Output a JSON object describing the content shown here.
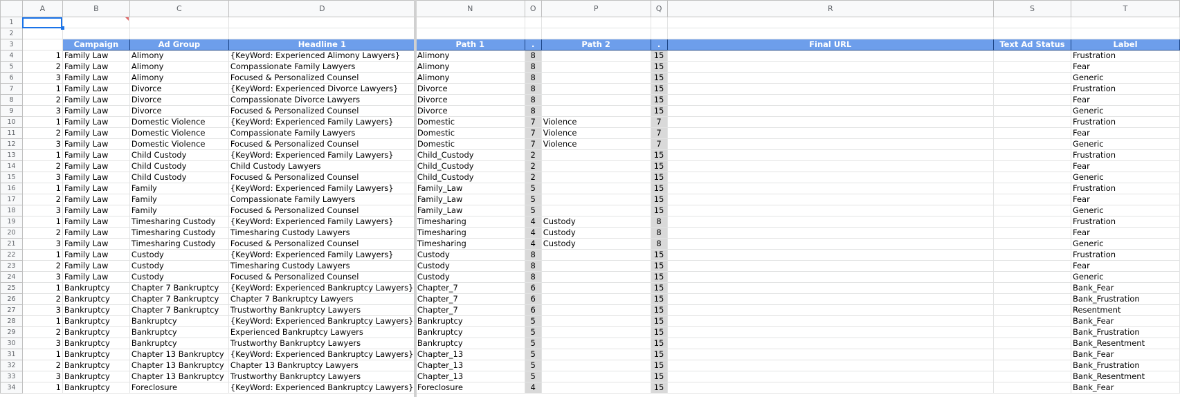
{
  "columns": [
    "",
    "A",
    "B",
    "C",
    "D",
    "N",
    "O",
    "P",
    "Q",
    "R",
    "S",
    "T"
  ],
  "row_numbers": [
    1,
    2,
    3,
    4,
    5,
    6,
    7,
    8,
    9,
    10,
    11,
    12,
    13,
    14,
    15,
    16,
    17,
    18,
    19,
    20,
    21,
    22,
    23,
    24,
    25,
    26,
    27,
    28,
    29,
    30,
    31,
    32,
    33,
    34
  ],
  "headers": {
    "campaign": "Campaign",
    "ad_group": "Ad Group",
    "headline1": "Headline 1",
    "path1": "Path 1",
    "dot1": ".",
    "path2": "Path 2",
    "dot2": ".",
    "final_url": "Final URL",
    "status": "Text Ad Status",
    "label": "Label"
  },
  "rows": [
    [
      "1",
      "Family Law",
      "Alimony",
      "{KeyWord: Experienced Alimony Lawyers}",
      "Alimony",
      "8",
      "",
      "15",
      "",
      "",
      "Frustration"
    ],
    [
      "2",
      "Family Law",
      "Alimony",
      "Compassionate Family Lawyers",
      "Alimony",
      "8",
      "",
      "15",
      "",
      "",
      "Fear"
    ],
    [
      "3",
      "Family Law",
      "Alimony",
      "Focused & Personalized Counsel",
      "Alimony",
      "8",
      "",
      "15",
      "",
      "",
      "Generic"
    ],
    [
      "1",
      "Family Law",
      "Divorce",
      "{KeyWord: Experienced Divorce Lawyers}",
      "Divorce",
      "8",
      "",
      "15",
      "",
      "",
      "Frustration"
    ],
    [
      "2",
      "Family Law",
      "Divorce",
      "Compassionate Divorce Lawyers",
      "Divorce",
      "8",
      "",
      "15",
      "",
      "",
      "Fear"
    ],
    [
      "3",
      "Family Law",
      "Divorce",
      "Focused & Personalized Counsel",
      "Divorce",
      "8",
      "",
      "15",
      "",
      "",
      "Generic"
    ],
    [
      "1",
      "Family Law",
      "Domestic Violence",
      "{KeyWord: Experienced Family Lawyers}",
      "Domestic",
      "7",
      "Violence",
      "7",
      "",
      "",
      "Frustration"
    ],
    [
      "2",
      "Family Law",
      "Domestic Violence",
      "Compassionate Family Lawyers",
      "Domestic",
      "7",
      "Violence",
      "7",
      "",
      "",
      "Fear"
    ],
    [
      "3",
      "Family Law",
      "Domestic Violence",
      "Focused & Personalized Counsel",
      "Domestic",
      "7",
      "Violence",
      "7",
      "",
      "",
      "Generic"
    ],
    [
      "1",
      "Family Law",
      "Child Custody",
      "{KeyWord: Experienced Family Lawyers}",
      "Child_Custody",
      "2",
      "",
      "15",
      "",
      "",
      "Frustration"
    ],
    [
      "2",
      "Family Law",
      "Child Custody",
      "Child Custody Lawyers",
      "Child_Custody",
      "2",
      "",
      "15",
      "",
      "",
      "Fear"
    ],
    [
      "3",
      "Family Law",
      "Child Custody",
      "Focused & Personalized Counsel",
      "Child_Custody",
      "2",
      "",
      "15",
      "",
      "",
      "Generic"
    ],
    [
      "1",
      "Family Law",
      "Family",
      "{KeyWord: Experienced Family Lawyers}",
      "Family_Law",
      "5",
      "",
      "15",
      "",
      "",
      "Frustration"
    ],
    [
      "2",
      "Family Law",
      "Family",
      "Compassionate Family Lawyers",
      "Family_Law",
      "5",
      "",
      "15",
      "",
      "",
      "Fear"
    ],
    [
      "3",
      "Family Law",
      "Family",
      "Focused & Personalized Counsel",
      "Family_Law",
      "5",
      "",
      "15",
      "",
      "",
      "Generic"
    ],
    [
      "1",
      "Family Law",
      "Timesharing Custody",
      "{KeyWord: Experienced Family Lawyers}",
      "Timesharing",
      "4",
      "Custody",
      "8",
      "",
      "",
      "Frustration"
    ],
    [
      "2",
      "Family Law",
      "Timesharing Custody",
      "Timesharing Custody Lawyers",
      "Timesharing",
      "4",
      "Custody",
      "8",
      "",
      "",
      "Fear"
    ],
    [
      "3",
      "Family Law",
      "Timesharing Custody",
      "Focused & Personalized Counsel",
      "Timesharing",
      "4",
      "Custody",
      "8",
      "",
      "",
      "Generic"
    ],
    [
      "1",
      "Family Law",
      "Custody",
      "{KeyWord: Experienced Family Lawyers}",
      "Custody",
      "8",
      "",
      "15",
      "",
      "",
      "Frustration"
    ],
    [
      "2",
      "Family Law",
      "Custody",
      "Timesharing Custody Lawyers",
      "Custody",
      "8",
      "",
      "15",
      "",
      "",
      "Fear"
    ],
    [
      "3",
      "Family Law",
      "Custody",
      "Focused & Personalized Counsel",
      "Custody",
      "8",
      "",
      "15",
      "",
      "",
      "Generic"
    ],
    [
      "1",
      "Bankruptcy",
      "Chapter 7 Bankruptcy",
      "{KeyWord: Experienced Bankruptcy Lawyers}",
      "Chapter_7",
      "6",
      "",
      "15",
      "",
      "",
      "Bank_Fear"
    ],
    [
      "2",
      "Bankruptcy",
      "Chapter 7 Bankruptcy",
      "Chapter 7 Bankruptcy Lawyers",
      "Chapter_7",
      "6",
      "",
      "15",
      "",
      "",
      "Bank_Frustration"
    ],
    [
      "3",
      "Bankruptcy",
      "Chapter 7 Bankruptcy",
      "Trustworthy Bankruptcy Lawyers",
      "Chapter_7",
      "6",
      "",
      "15",
      "",
      "",
      "Resentment"
    ],
    [
      "1",
      "Bankruptcy",
      "Bankruptcy",
      "{KeyWord: Experienced Bankruptcy Lawyers}",
      "Bankruptcy",
      "5",
      "",
      "15",
      "",
      "",
      "Bank_Fear"
    ],
    [
      "2",
      "Bankruptcy",
      "Bankruptcy",
      "Experienced Bankruptcy Lawyers",
      "Bankruptcy",
      "5",
      "",
      "15",
      "",
      "",
      "Bank_Frustration"
    ],
    [
      "3",
      "Bankruptcy",
      "Bankruptcy",
      "Trustworthy Bankruptcy Lawyers",
      "Bankruptcy",
      "5",
      "",
      "15",
      "",
      "",
      "Bank_Resentment"
    ],
    [
      "1",
      "Bankruptcy",
      "Chapter 13 Bankruptcy",
      "{KeyWord: Experienced Bankruptcy Lawyers}",
      "Chapter_13",
      "5",
      "",
      "15",
      "",
      "",
      "Bank_Fear"
    ],
    [
      "2",
      "Bankruptcy",
      "Chapter 13 Bankruptcy",
      "Chapter 13  Bankruptcy Lawyers",
      "Chapter_13",
      "5",
      "",
      "15",
      "",
      "",
      "Bank_Frustration"
    ],
    [
      "3",
      "Bankruptcy",
      "Chapter 13 Bankruptcy",
      "Trustworthy Bankruptcy Lawyers",
      "Chapter_13",
      "5",
      "",
      "15",
      "",
      "",
      "Bank_Resentment"
    ],
    [
      "1",
      "Bankruptcy",
      "Foreclosure",
      "{KeyWord: Experienced Bankruptcy Lawyers}",
      "Foreclosure",
      "4",
      "",
      "15",
      "",
      "",
      "Bank_Fear"
    ]
  ],
  "colors": {
    "header_fill": "#6d9eeb",
    "header_border": "#1c4587",
    "grey_fill": "#d9d9d9",
    "selection": "#1a73e8"
  }
}
